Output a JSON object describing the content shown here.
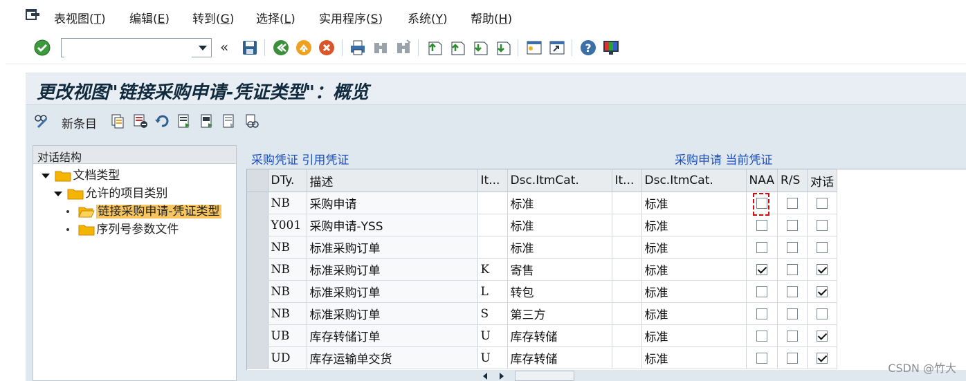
{
  "menu": {
    "items": [
      {
        "text": "表视图(",
        "key": "T",
        "end": ")"
      },
      {
        "text": "编辑(",
        "key": "E",
        "end": ")"
      },
      {
        "text": "转到(",
        "key": "G",
        "end": ")"
      },
      {
        "text": "选择(",
        "key": "L",
        "end": ")"
      },
      {
        "text": "实用程序(",
        "key": "S",
        "end": ")"
      },
      {
        "text": "系统(",
        "key": "Y",
        "end": ")"
      },
      {
        "text": "帮助(",
        "key": "H",
        "end": ")"
      }
    ]
  },
  "toolbar": {
    "command_value": "",
    "chevron": "«"
  },
  "title": "更改视图\"链接采购申请-凭证类型\"：概览",
  "app_toolbar": {
    "new_entries_label": "新条目"
  },
  "tree": {
    "header": "对话结构",
    "nodes": [
      {
        "label": "文档类型"
      },
      {
        "label": "允许的项目类别"
      },
      {
        "label": "链接采购申请-凭证类型"
      },
      {
        "label": "序列号参数文件"
      }
    ]
  },
  "section_labels": {
    "left": "采购凭证 引用凭证",
    "right": "采购申请 当前凭证"
  },
  "table": {
    "columns": [
      "DTy.",
      "描述",
      "It...",
      "Dsc.ItmCat.",
      "It...",
      "Dsc.ItmCat.",
      "NAA",
      "R/S",
      "对话"
    ],
    "rows": [
      {
        "dty": "NB",
        "desc": "采购申请",
        "it1": "",
        "dsc1": "标准",
        "it2": "",
        "dsc2": "标准",
        "naa": false,
        "rs": false,
        "dlg": false
      },
      {
        "dty": "Y001",
        "desc": "采购申请-YSS",
        "it1": "",
        "dsc1": "标准",
        "it2": "",
        "dsc2": "标准",
        "naa": false,
        "rs": false,
        "dlg": false
      },
      {
        "dty": "NB",
        "desc": "标准采购订单",
        "it1": "",
        "dsc1": "标准",
        "it2": "",
        "dsc2": "标准",
        "naa": false,
        "rs": false,
        "dlg": false
      },
      {
        "dty": "NB",
        "desc": "标准采购订单",
        "it1": "K",
        "dsc1": "寄售",
        "it2": "",
        "dsc2": "标准",
        "naa": true,
        "rs": false,
        "dlg": true
      },
      {
        "dty": "NB",
        "desc": "标准采购订单",
        "it1": "L",
        "dsc1": "转包",
        "it2": "",
        "dsc2": "标准",
        "naa": false,
        "rs": false,
        "dlg": true
      },
      {
        "dty": "NB",
        "desc": "标准采购订单",
        "it1": "S",
        "dsc1": "第三方",
        "it2": "",
        "dsc2": "标准",
        "naa": false,
        "rs": false,
        "dlg": false
      },
      {
        "dty": "UB",
        "desc": "库存转储订单",
        "it1": "U",
        "dsc1": "库存转储",
        "it2": "",
        "dsc2": "标准",
        "naa": false,
        "rs": false,
        "dlg": true
      },
      {
        "dty": "UD",
        "desc": "库存运输单交货",
        "it1": "U",
        "dsc1": "库存转储",
        "it2": "",
        "dsc2": "标准",
        "naa": false,
        "rs": false,
        "dlg": true
      }
    ]
  },
  "watermark": "CSDN @竹大",
  "colors": {
    "accent_blue": "#1a4fbf",
    "selection": "#f6c560",
    "title": "#102a3e"
  }
}
